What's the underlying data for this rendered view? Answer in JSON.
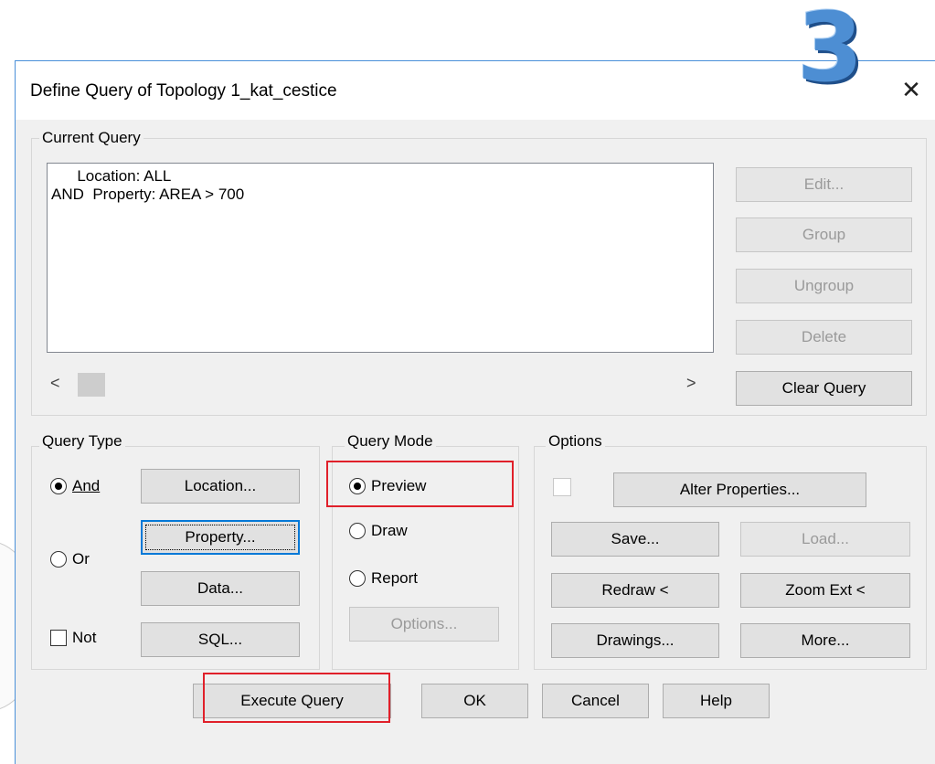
{
  "step_number": "3",
  "dialog": {
    "title": "Define Query of Topology 1_kat_cestice",
    "close_glyph": "✕"
  },
  "current_query": {
    "group_label": "Current Query",
    "lines": [
      "      Location: ALL",
      "AND  Property: AREA > 700"
    ],
    "scroll_left": "<",
    "scroll_right": ">",
    "buttons": {
      "edit": "Edit...",
      "group": "Group",
      "ungroup": "Ungroup",
      "delete": "Delete",
      "clear": "Clear Query"
    }
  },
  "query_type": {
    "group_label": "Query Type",
    "and_label": "And",
    "or_label": "Or",
    "not_label": "Not",
    "selected": "And",
    "not_checked": false,
    "buttons": {
      "location": "Location...",
      "property": "Property...",
      "data": "Data...",
      "sql": "SQL..."
    }
  },
  "query_mode": {
    "group_label": "Query Mode",
    "preview_label": "Preview",
    "draw_label": "Draw",
    "report_label": "Report",
    "selected": "Preview",
    "options_button": "Options..."
  },
  "options": {
    "group_label": "Options",
    "alter_properties": "Alter Properties...",
    "save": "Save...",
    "load": "Load...",
    "redraw": "Redraw <",
    "zoom_ext": "Zoom Ext <",
    "drawings": "Drawings...",
    "more": "More..."
  },
  "footer": {
    "execute": "Execute Query",
    "ok": "OK",
    "cancel": "Cancel",
    "help": "Help"
  },
  "colors": {
    "highlight": "#e0202a",
    "accent_border": "#4a90d9",
    "step_number": "#4d8ed3"
  }
}
